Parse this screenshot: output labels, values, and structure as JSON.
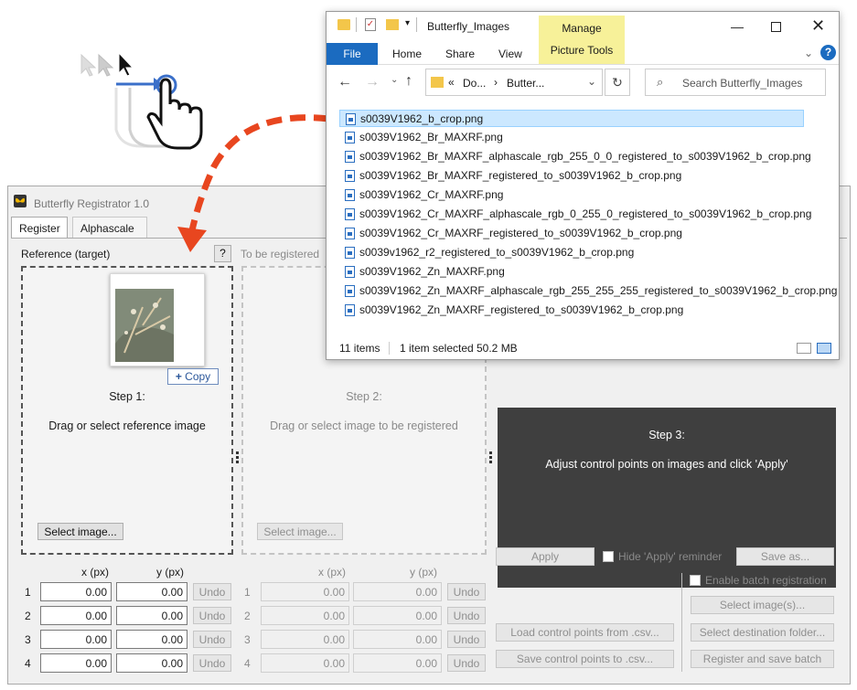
{
  "app": {
    "title": "Butterfly Registrator 1.0",
    "tabs": [
      "Register",
      "Alphascale"
    ],
    "reference_label": "Reference (target)",
    "help_label": "?",
    "to_register_label": "To be registered",
    "copy_label": "Copy",
    "step1_title": "Step 1:",
    "step1_text": "Drag or select reference image",
    "step2_title": "Step 2:",
    "step2_text": "Drag or select image to be registered",
    "step3_title": "Step 3:",
    "step3_text": "Adjust control points on images and click 'Apply'",
    "select_image_label": "Select image...",
    "x_header": "x (px)",
    "y_header": "y (px)",
    "row_numbers": [
      "1",
      "2",
      "3",
      "4"
    ],
    "ref_points": [
      [
        "0.00",
        "0.00"
      ],
      [
        "0.00",
        "0.00"
      ],
      [
        "0.00",
        "0.00"
      ],
      [
        "0.00",
        "0.00"
      ]
    ],
    "reg_points": [
      [
        "0.00",
        "0.00"
      ],
      [
        "0.00",
        "0.00"
      ],
      [
        "0.00",
        "0.00"
      ],
      [
        "0.00",
        "0.00"
      ]
    ],
    "undo_label": "Undo",
    "apply_label": "Apply",
    "hide_apply_label": "Hide 'Apply' reminder",
    "save_as_label": "Save as...",
    "enable_batch_label": "Enable batch registration",
    "select_images_label": "Select image(s)...",
    "select_dest_label": "Select destination folder...",
    "load_csv_label": "Load control points from .csv...",
    "save_csv_label": "Save control points to .csv...",
    "register_batch_label": "Register and save batch"
  },
  "explorer": {
    "title": "Butterfly_Images",
    "manage_label": "Manage",
    "picture_tools_label": "Picture Tools",
    "ribbon_tabs": [
      "File",
      "Home",
      "Share",
      "View"
    ],
    "address_parts": [
      "Do...",
      "Butter..."
    ],
    "search_placeholder": "Search Butterfly_Images",
    "files": [
      "s0039V1962_b_crop.png",
      "s0039V1962_Br_MAXRF.png",
      "s0039V1962_Br_MAXRF_alphascale_rgb_255_0_0_registered_to_s0039V1962_b_crop.png",
      "s0039V1962_Br_MAXRF_registered_to_s0039V1962_b_crop.png",
      "s0039V1962_Cr_MAXRF.png",
      "s0039V1962_Cr_MAXRF_alphascale_rgb_0_255_0_registered_to_s0039V1962_b_crop.png",
      "s0039V1962_Cr_MAXRF_registered_to_s0039V1962_b_crop.png",
      "s0039v1962_r2_registered_to_s0039V1962_b_crop.png",
      "s0039V1962_Zn_MAXRF.png",
      "s0039V1962_Zn_MAXRF_alphascale_rgb_255_255_255_registered_to_s0039V1962_b_crop.png",
      "s0039V1962_Zn_MAXRF_registered_to_s0039V1962_b_crop.png"
    ],
    "selected_index": 0,
    "item_count": "11 items",
    "selection_info": "1 item selected",
    "selection_size": "50.2 MB"
  },
  "colors": {
    "accent": "#1b6bc0",
    "arrow": "#e8461f",
    "manage": "#f7f199",
    "dark_panel": "#3f3f3f"
  }
}
